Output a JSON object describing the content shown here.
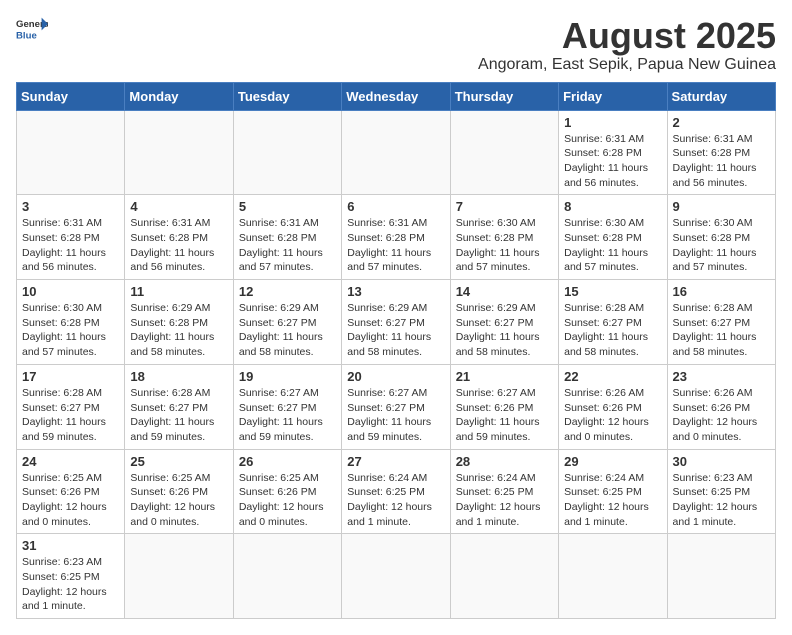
{
  "header": {
    "logo_general": "General",
    "logo_blue": "Blue",
    "month_year": "August 2025",
    "location": "Angoram, East Sepik, Papua New Guinea"
  },
  "days_of_week": [
    "Sunday",
    "Monday",
    "Tuesday",
    "Wednesday",
    "Thursday",
    "Friday",
    "Saturday"
  ],
  "weeks": [
    [
      {
        "day": "",
        "info": ""
      },
      {
        "day": "",
        "info": ""
      },
      {
        "day": "",
        "info": ""
      },
      {
        "day": "",
        "info": ""
      },
      {
        "day": "",
        "info": ""
      },
      {
        "day": "1",
        "info": "Sunrise: 6:31 AM\nSunset: 6:28 PM\nDaylight: 11 hours and 56 minutes."
      },
      {
        "day": "2",
        "info": "Sunrise: 6:31 AM\nSunset: 6:28 PM\nDaylight: 11 hours and 56 minutes."
      }
    ],
    [
      {
        "day": "3",
        "info": "Sunrise: 6:31 AM\nSunset: 6:28 PM\nDaylight: 11 hours and 56 minutes."
      },
      {
        "day": "4",
        "info": "Sunrise: 6:31 AM\nSunset: 6:28 PM\nDaylight: 11 hours and 56 minutes."
      },
      {
        "day": "5",
        "info": "Sunrise: 6:31 AM\nSunset: 6:28 PM\nDaylight: 11 hours and 57 minutes."
      },
      {
        "day": "6",
        "info": "Sunrise: 6:31 AM\nSunset: 6:28 PM\nDaylight: 11 hours and 57 minutes."
      },
      {
        "day": "7",
        "info": "Sunrise: 6:30 AM\nSunset: 6:28 PM\nDaylight: 11 hours and 57 minutes."
      },
      {
        "day": "8",
        "info": "Sunrise: 6:30 AM\nSunset: 6:28 PM\nDaylight: 11 hours and 57 minutes."
      },
      {
        "day": "9",
        "info": "Sunrise: 6:30 AM\nSunset: 6:28 PM\nDaylight: 11 hours and 57 minutes."
      }
    ],
    [
      {
        "day": "10",
        "info": "Sunrise: 6:30 AM\nSunset: 6:28 PM\nDaylight: 11 hours and 57 minutes."
      },
      {
        "day": "11",
        "info": "Sunrise: 6:29 AM\nSunset: 6:28 PM\nDaylight: 11 hours and 58 minutes."
      },
      {
        "day": "12",
        "info": "Sunrise: 6:29 AM\nSunset: 6:27 PM\nDaylight: 11 hours and 58 minutes."
      },
      {
        "day": "13",
        "info": "Sunrise: 6:29 AM\nSunset: 6:27 PM\nDaylight: 11 hours and 58 minutes."
      },
      {
        "day": "14",
        "info": "Sunrise: 6:29 AM\nSunset: 6:27 PM\nDaylight: 11 hours and 58 minutes."
      },
      {
        "day": "15",
        "info": "Sunrise: 6:28 AM\nSunset: 6:27 PM\nDaylight: 11 hours and 58 minutes."
      },
      {
        "day": "16",
        "info": "Sunrise: 6:28 AM\nSunset: 6:27 PM\nDaylight: 11 hours and 58 minutes."
      }
    ],
    [
      {
        "day": "17",
        "info": "Sunrise: 6:28 AM\nSunset: 6:27 PM\nDaylight: 11 hours and 59 minutes."
      },
      {
        "day": "18",
        "info": "Sunrise: 6:28 AM\nSunset: 6:27 PM\nDaylight: 11 hours and 59 minutes."
      },
      {
        "day": "19",
        "info": "Sunrise: 6:27 AM\nSunset: 6:27 PM\nDaylight: 11 hours and 59 minutes."
      },
      {
        "day": "20",
        "info": "Sunrise: 6:27 AM\nSunset: 6:27 PM\nDaylight: 11 hours and 59 minutes."
      },
      {
        "day": "21",
        "info": "Sunrise: 6:27 AM\nSunset: 6:26 PM\nDaylight: 11 hours and 59 minutes."
      },
      {
        "day": "22",
        "info": "Sunrise: 6:26 AM\nSunset: 6:26 PM\nDaylight: 12 hours and 0 minutes."
      },
      {
        "day": "23",
        "info": "Sunrise: 6:26 AM\nSunset: 6:26 PM\nDaylight: 12 hours and 0 minutes."
      }
    ],
    [
      {
        "day": "24",
        "info": "Sunrise: 6:25 AM\nSunset: 6:26 PM\nDaylight: 12 hours and 0 minutes."
      },
      {
        "day": "25",
        "info": "Sunrise: 6:25 AM\nSunset: 6:26 PM\nDaylight: 12 hours and 0 minutes."
      },
      {
        "day": "26",
        "info": "Sunrise: 6:25 AM\nSunset: 6:26 PM\nDaylight: 12 hours and 0 minutes."
      },
      {
        "day": "27",
        "info": "Sunrise: 6:24 AM\nSunset: 6:25 PM\nDaylight: 12 hours and 1 minute."
      },
      {
        "day": "28",
        "info": "Sunrise: 6:24 AM\nSunset: 6:25 PM\nDaylight: 12 hours and 1 minute."
      },
      {
        "day": "29",
        "info": "Sunrise: 6:24 AM\nSunset: 6:25 PM\nDaylight: 12 hours and 1 minute."
      },
      {
        "day": "30",
        "info": "Sunrise: 6:23 AM\nSunset: 6:25 PM\nDaylight: 12 hours and 1 minute."
      }
    ],
    [
      {
        "day": "31",
        "info": "Sunrise: 6:23 AM\nSunset: 6:25 PM\nDaylight: 12 hours and 1 minute."
      },
      {
        "day": "",
        "info": ""
      },
      {
        "day": "",
        "info": ""
      },
      {
        "day": "",
        "info": ""
      },
      {
        "day": "",
        "info": ""
      },
      {
        "day": "",
        "info": ""
      },
      {
        "day": "",
        "info": ""
      }
    ]
  ]
}
